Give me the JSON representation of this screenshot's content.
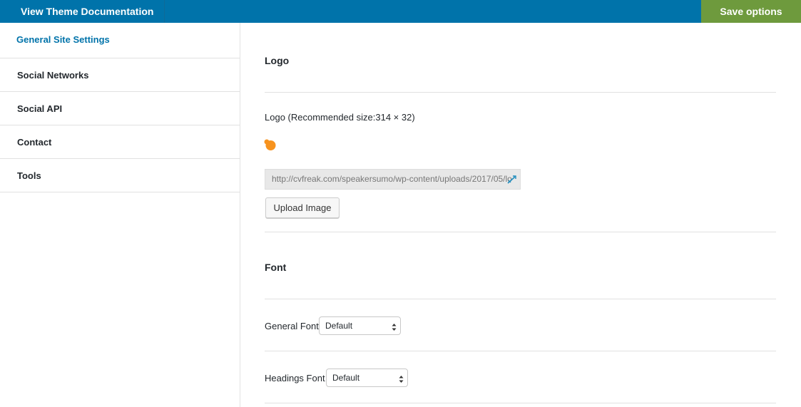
{
  "topbar": {
    "doc_link_label": "View Theme Documentation",
    "save_label": "Save options",
    "bar_color": "#0073aa",
    "save_color": "#6e9a3d"
  },
  "sidebar": {
    "items": [
      {
        "label": "General Site Settings",
        "active": true
      },
      {
        "label": "Social Networks",
        "active": false
      },
      {
        "label": "Social API",
        "active": false
      },
      {
        "label": "Contact",
        "active": false
      },
      {
        "label": "Tools",
        "active": false
      }
    ]
  },
  "main": {
    "logo_section": {
      "title": "Logo",
      "field_label": "Logo (Recommended size:314 × 32)",
      "logo_preview_icon": "orange-dot-logo-icon",
      "url_value": "http://cvfreak.com/speakersumo/wp-content/uploads/2017/05/lo",
      "upload_label": "Upload Image"
    },
    "font_section": {
      "title": "Font",
      "general_font_label": "General Font",
      "general_font_value": "Default",
      "headings_font_label": "Headings Font",
      "headings_font_value": "Default"
    }
  }
}
